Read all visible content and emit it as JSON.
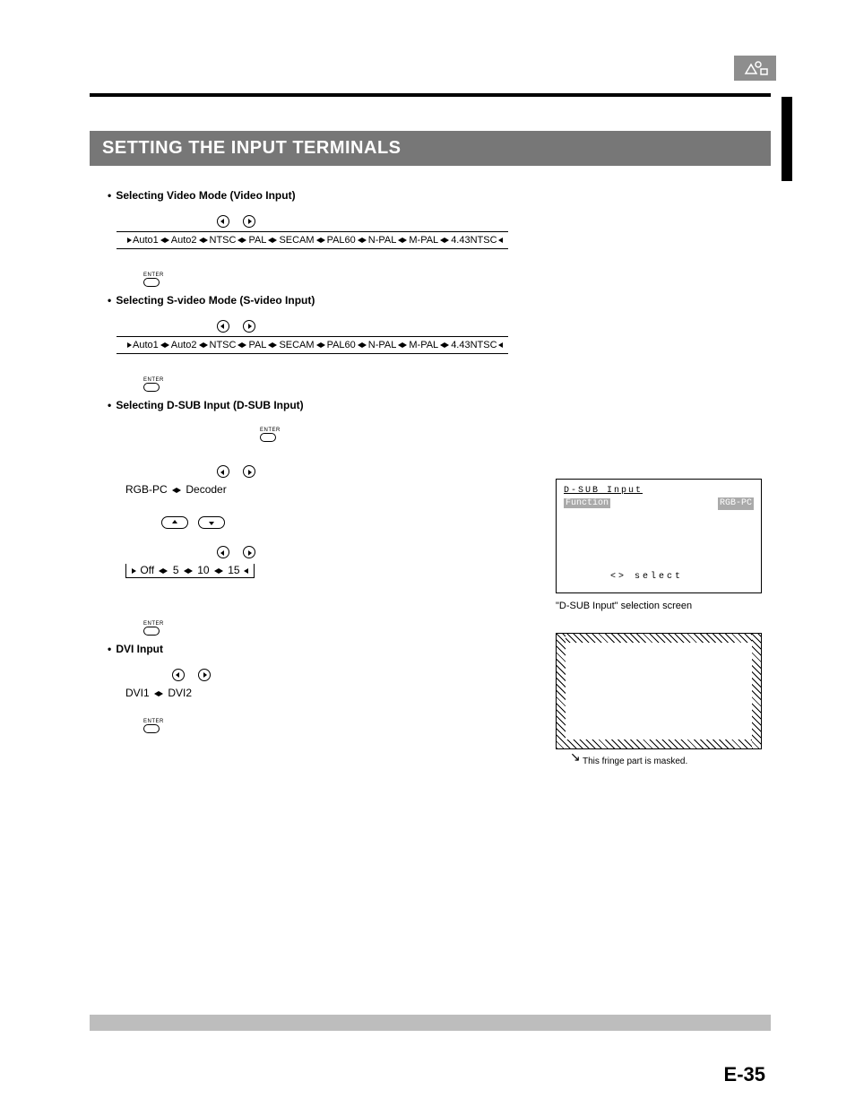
{
  "header": {
    "section_title": "SETTING THE INPUT TERMINALS"
  },
  "sections": {
    "video": {
      "bullet": "Selecting Video Mode (Video Input)"
    },
    "svideo": {
      "bullet": "Selecting S-video Mode (S-video Input)"
    },
    "dsub": {
      "bullet": "Selecting D-SUB Input (D-SUB Input)",
      "pair_a": "RGB-PC",
      "pair_b": "Decoder",
      "mask_opts": [
        "Off",
        "5",
        "10",
        "15"
      ]
    },
    "dvi": {
      "bullet": "DVI Input",
      "opt_a": "DVI1",
      "opt_b": "DVI2"
    }
  },
  "cycle_options": [
    "Auto1",
    "Auto2",
    "NTSC",
    "PAL",
    "SECAM",
    "PAL60",
    "N-PAL",
    "M-PAL",
    "4.43NTSC"
  ],
  "osd": {
    "title": "D-SUB Input",
    "row1_label": "Function",
    "row1_value": "RGB-PC",
    "select_hint": "<> select",
    "caption": "\"D-SUB Input\" selection screen"
  },
  "mask": {
    "caption": "This fringe part is masked."
  },
  "page_number": "E-35",
  "enter_label": "ENTER"
}
